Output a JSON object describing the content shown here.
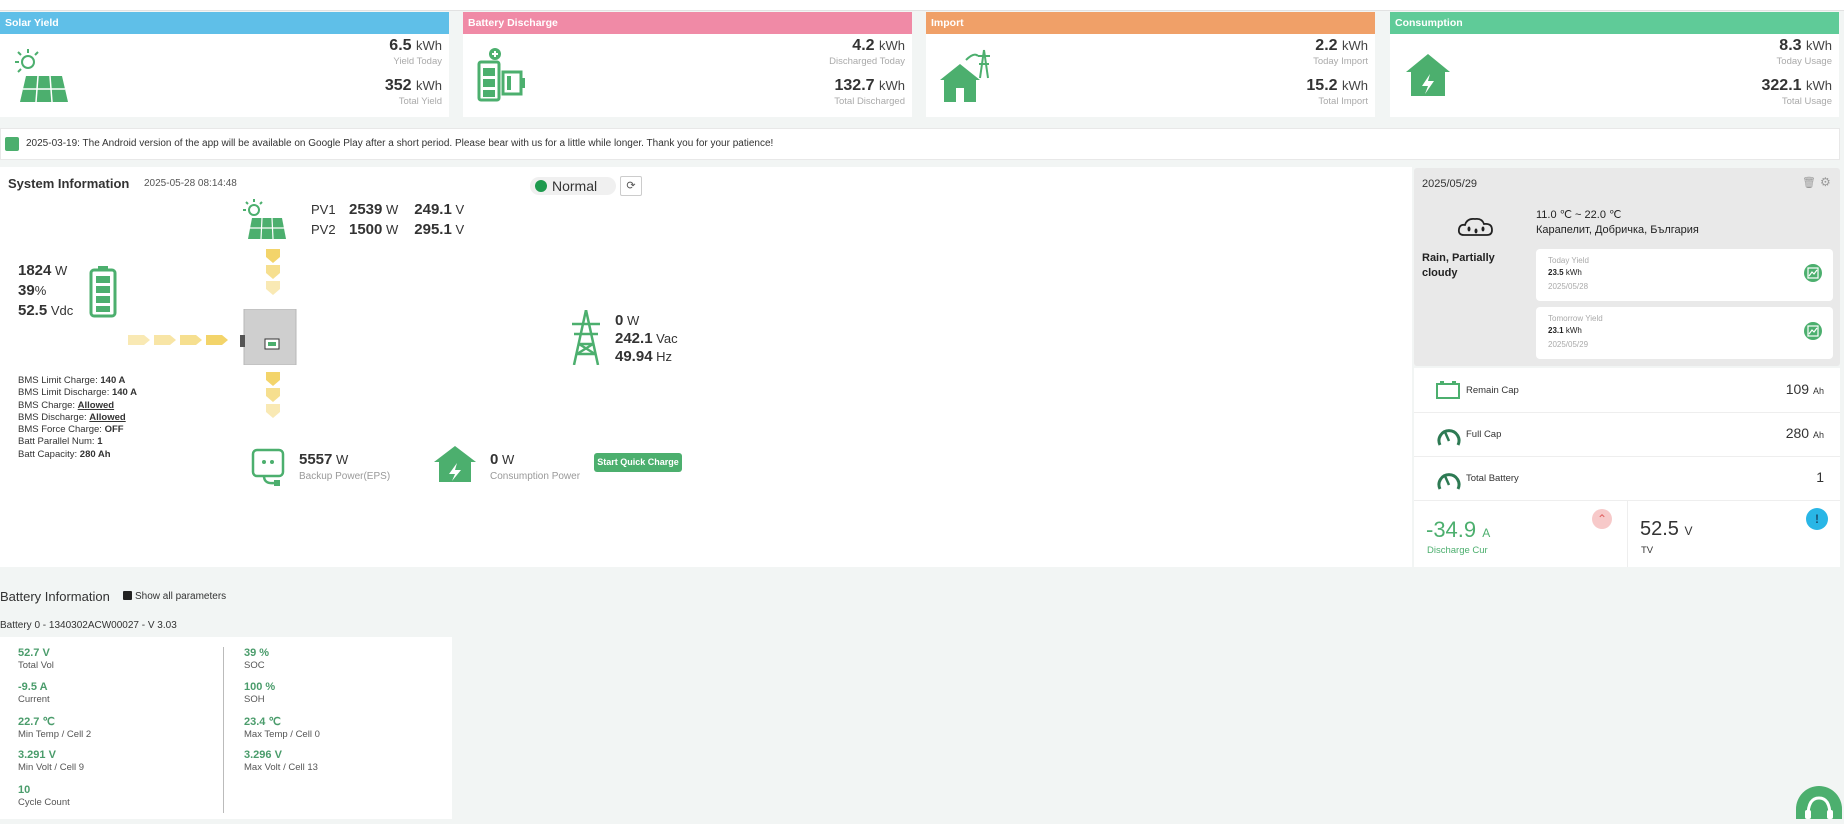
{
  "cards": [
    {
      "title": "Solar Yield",
      "color": "#5fbfe8",
      "v1": "6.5",
      "u1": "kWh",
      "l1": "Yield Today",
      "v2": "352",
      "u2": "kWh",
      "l2": "Total Yield",
      "icon": "solar-panel-icon"
    },
    {
      "title": "Battery Discharge",
      "color": "#f08aa6",
      "v1": "4.2",
      "u1": "kWh",
      "l1": "Discharged Today",
      "v2": "132.7",
      "u2": "kWh",
      "l2": "Total Discharged",
      "icon": "battery-icon"
    },
    {
      "title": "Import",
      "color": "#f0a068",
      "v1": "2.2",
      "u1": "kWh",
      "l1": "Today Import",
      "v2": "15.2",
      "u2": "kWh",
      "l2": "Total Import",
      "icon": "house-grid-icon"
    },
    {
      "title": "Consumption",
      "color": "#5fcb98",
      "v1": "8.3",
      "u1": "kWh",
      "l1": "Today Usage",
      "v2": "322.1",
      "u2": "kWh",
      "l2": "Total Usage",
      "icon": "house-bolt-icon"
    }
  ],
  "notice": "2025-03-19: The Android version of the app will be available on Google Play after a short period. Please bear with us for a little while longer. Thank you for your patience!",
  "system": {
    "title": "System Information",
    "timestamp": "2025-05-28 08:14:48",
    "pv1": {
      "label": "PV1",
      "w": "2539",
      "wu": "W",
      "v": "249.1",
      "vu": "V"
    },
    "pv2": {
      "label": "PV2",
      "w": "1500",
      "wu": "W",
      "v": "295.1",
      "vu": "V"
    },
    "status": "Normal",
    "battery": {
      "power": "1824",
      "pu": "W",
      "soc": "39",
      "socu": "%",
      "volt": "52.5",
      "vu": "Vdc"
    },
    "bms": [
      {
        "k": "BMS Limit Charge:",
        "v": "140 A",
        "u": false
      },
      {
        "k": "BMS Limit Discharge:",
        "v": "140 A",
        "u": false
      },
      {
        "k": "BMS Charge:",
        "v": "Allowed",
        "u": true
      },
      {
        "k": "BMS Discharge:",
        "v": "Allowed",
        "u": true
      },
      {
        "k": "BMS Force Charge:",
        "v": "OFF",
        "u": false
      },
      {
        "k": "Batt Parallel Num:",
        "v": "1",
        "u": false
      },
      {
        "k": "Batt Capacity:",
        "v": "280 Ah",
        "u": false
      }
    ],
    "grid": {
      "w": "0",
      "wu": "W",
      "vac": "242.1",
      "vacu": "Vac",
      "hz": "49.94",
      "hzu": "Hz"
    },
    "eps": {
      "w": "5557",
      "wu": "W",
      "label": "Backup Power(EPS)"
    },
    "consumption": {
      "w": "0",
      "wu": "W",
      "label": "Consumption Power"
    },
    "quick_charge": "Start Quick Charge"
  },
  "weather": {
    "date": "2025/05/29",
    "temp": "11.0 ℃ ~ 22.0 ℃",
    "location": "Карапелит, Добричка, България",
    "condition": "Rain, Partially cloudy",
    "today": {
      "label": "Today Yield",
      "value": "23.5",
      "unit": "kWh",
      "date": "2025/05/28"
    },
    "tomorrow": {
      "label": "Tomorrow Yield",
      "value": "23.1",
      "unit": "kWh",
      "date": "2025/05/29"
    }
  },
  "stats": [
    {
      "label": "Remain Cap",
      "value": "109",
      "unit": "Ah",
      "icon": "battery-outline-icon"
    },
    {
      "label": "Full Cap",
      "value": "280",
      "unit": "Ah",
      "icon": "gauge-icon"
    },
    {
      "label": "Total Battery",
      "value": "1",
      "unit": "",
      "icon": "gauge-icon"
    }
  ],
  "discharge": {
    "value": "-34.9",
    "unit": "A",
    "label": "Discharge Cur"
  },
  "tv": {
    "value": "52.5",
    "unit": "V",
    "label": "TV"
  },
  "batt_info": {
    "title": "Battery Information",
    "show_all": "Show all parameters",
    "battery_id": "Battery 0 - 1340302ACW00027 - V 3.03",
    "left": [
      {
        "v": "52.7 V",
        "l": "Total Vol"
      },
      {
        "v": "-9.5 A",
        "l": "Current"
      },
      {
        "v": "22.7 ℃",
        "l": "Min Temp / Cell 2"
      },
      {
        "v": "3.291 V",
        "l": "Min Volt / Cell 9"
      },
      {
        "v": "10",
        "l": "Cycle Count"
      }
    ],
    "right": [
      {
        "v": "39 %",
        "l": "SOC"
      },
      {
        "v": "100 %",
        "l": "SOH"
      },
      {
        "v": "23.4 ℃",
        "l": "Max Temp / Cell 0"
      },
      {
        "v": "3.296 V",
        "l": "Max Volt / Cell 13"
      }
    ]
  }
}
